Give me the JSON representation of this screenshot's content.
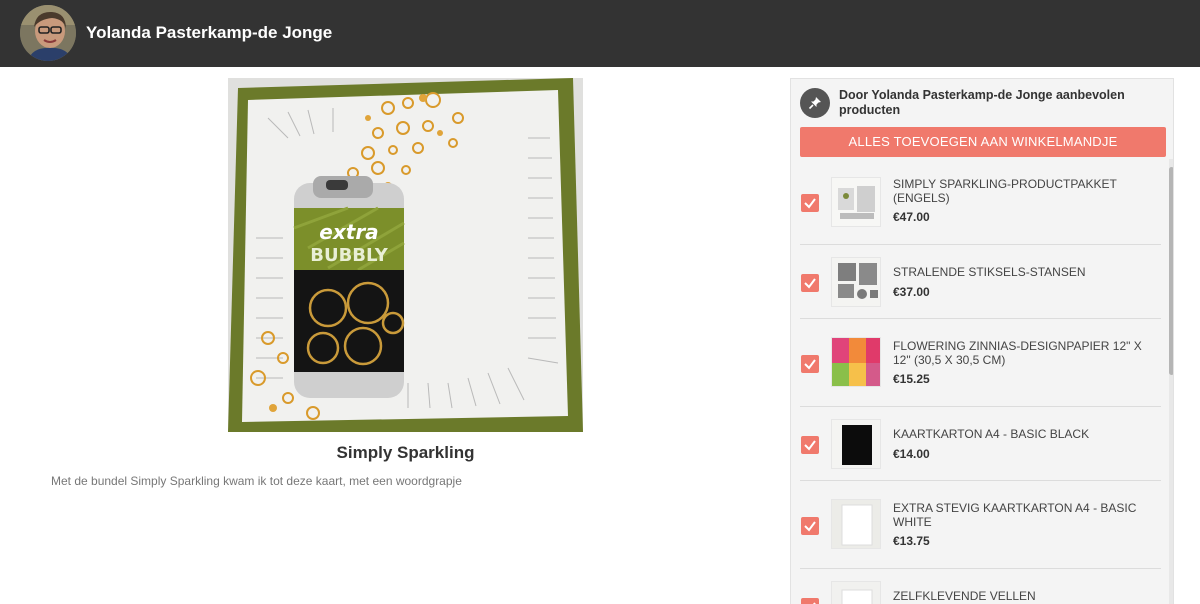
{
  "header": {
    "brand_name": "Yolanda Pasterkamp-de Jonge"
  },
  "main": {
    "image_can_text_1": "extra",
    "image_can_text_2": "BUBBLY",
    "title": "Simply Sparkling",
    "description": "Met de bundel Simply Sparkling kwam ik tot deze kaart, met een woordgrapje"
  },
  "panel": {
    "title": "Door Yolanda Pasterkamp-de Jonge aanbevolen producten",
    "add_all_label": "ALLES TOEVOEGEN AAN WINKELMANDJE",
    "items": [
      {
        "name": "SIMPLY SPARKLING-PRODUCTPAKKET (ENGELS)",
        "price": "€47.00",
        "checked": true
      },
      {
        "name": "STRALENDE STIKSELS-STANSEN",
        "price": "€37.00",
        "checked": true
      },
      {
        "name": "FLOWERING ZINNIAS-DESIGNPAPIER 12\" X 12\" (30,5 X 30,5 CM)",
        "price": "€15.25",
        "checked": true
      },
      {
        "name": "KAARTKARTON A4 - BASIC BLACK",
        "price": "€14.00",
        "checked": true
      },
      {
        "name": "EXTRA STEVIG KAARTKARTON A4 - BASIC WHITE",
        "price": "€13.75",
        "checked": true
      },
      {
        "name": "ZELFKLEVENDE VELLEN",
        "price": "",
        "checked": true
      }
    ]
  },
  "colors": {
    "accent": "#f0796c",
    "header_bg": "#333333",
    "panel_bg": "#f4f4f4"
  }
}
